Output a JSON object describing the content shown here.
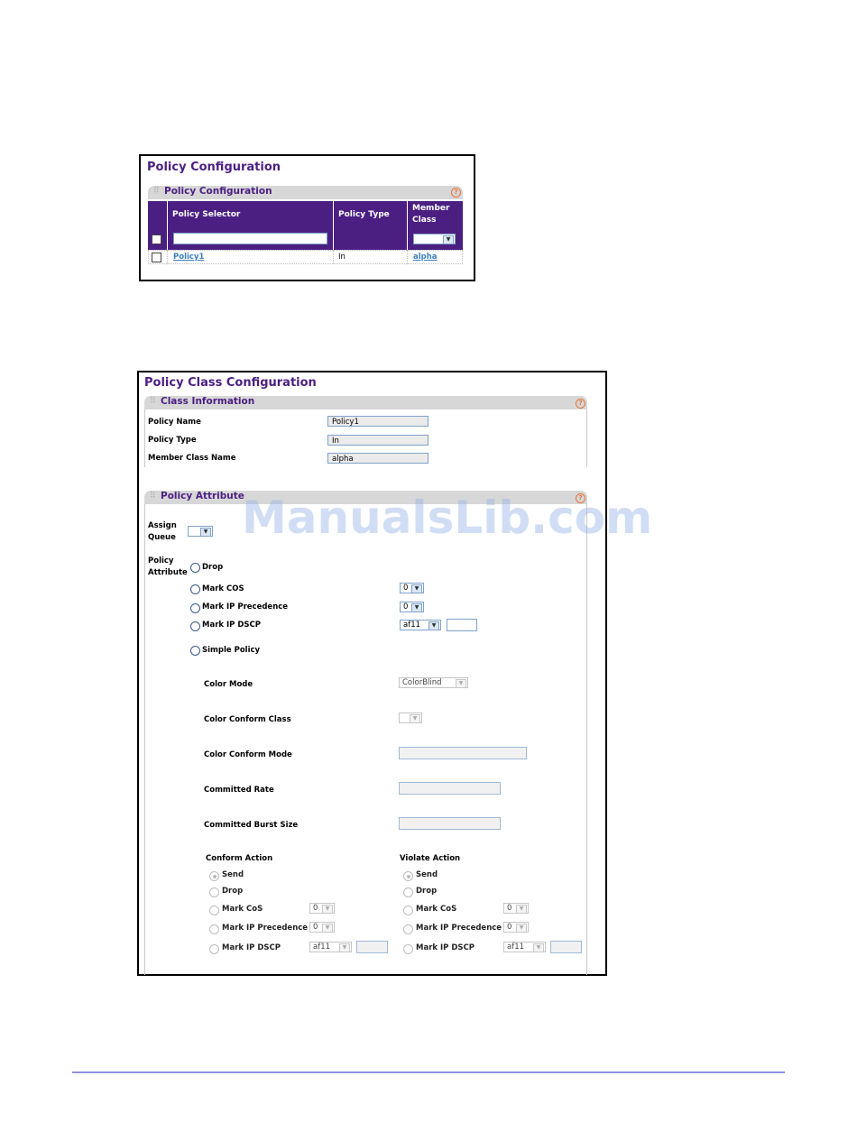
{
  "policy_config": {
    "title": "Policy Configuration",
    "section": "Policy Configuration",
    "help": "?",
    "columns": [
      "Policy Selector",
      "Policy Type",
      "Member Class"
    ],
    "member_class_header_line1": "Member",
    "member_class_header_line2": "Class",
    "new_row": {
      "selector": "",
      "type": "",
      "member_class": ""
    },
    "rows": [
      {
        "selector": "Policy1",
        "type": "In",
        "member_class": "alpha"
      }
    ]
  },
  "policy_class_config": {
    "title": "Policy Class Configuration",
    "class_info": {
      "section": "Class Information",
      "help": "?",
      "fields": [
        {
          "label": "Policy Name",
          "value": "Policy1"
        },
        {
          "label": "Policy Type",
          "value": "In"
        },
        {
          "label": "Member Class Name",
          "value": "alpha"
        }
      ]
    },
    "policy_attribute": {
      "section": "Policy Attribute",
      "help": "?",
      "assign_queue_line1": "Assign",
      "assign_queue_line2": "Queue",
      "assign_queue_value": "",
      "policy_attribute_line1": "Policy",
      "policy_attribute_line2": "Attribute",
      "options": {
        "drop": "Drop",
        "mark_cos": "Mark COS",
        "mark_cos_value": "0",
        "mark_ip_precedence": "Mark IP Precedence",
        "mark_ip_precedence_value": "0",
        "mark_ip_dscp": "Mark IP DSCP",
        "mark_ip_dscp_value": "af11",
        "simple_policy": "Simple Policy"
      },
      "simple_policy": {
        "color_mode_label": "Color Mode",
        "color_mode_value": "ColorBlind",
        "color_conform_class_label": "Color Conform Class",
        "color_conform_mode_label": "Color Conform Mode",
        "committed_rate_label": "Committed Rate",
        "committed_burst_size_label": "Committed Burst Size"
      },
      "conform_action": {
        "title": "Conform Action",
        "send": "Send",
        "drop": "Drop",
        "mark_cos": "Mark CoS",
        "mark_cos_value": "0",
        "mark_ip_precedence": "Mark IP Precedence",
        "mark_ip_precedence_value": "0",
        "mark_ip_dscp": "Mark IP DSCP",
        "mark_ip_dscp_value": "af11"
      },
      "violate_action": {
        "title": "Violate Action",
        "send": "Send",
        "drop": "Drop",
        "mark_cos": "Mark CoS",
        "mark_cos_value": "0",
        "mark_ip_precedence": "Mark IP Precedence",
        "mark_ip_precedence_value": "0",
        "mark_ip_dscp": "Mark IP DSCP",
        "mark_ip_dscp_value": "af11"
      }
    }
  },
  "watermark": "ManualsLib.com",
  "colors": {
    "accent": "#4b1f82",
    "section_bg": "#d7d7d7",
    "link": "#3b7fbf"
  }
}
